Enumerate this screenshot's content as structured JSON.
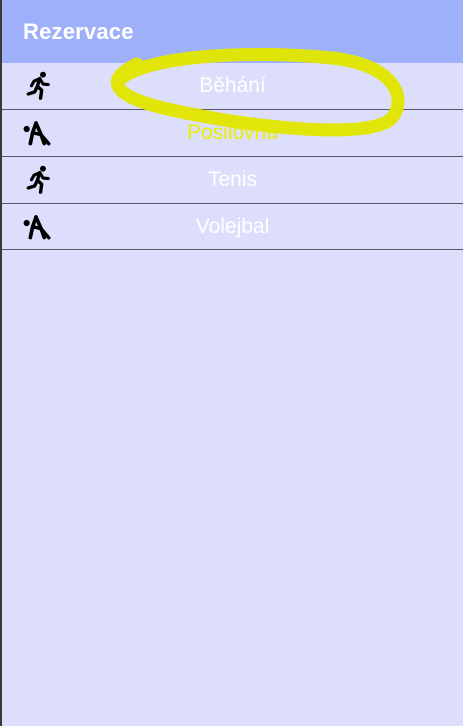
{
  "appbar": {
    "title": "Rezervace"
  },
  "list": {
    "items": [
      {
        "label": "Běhání",
        "icon": "running-person-icon"
      },
      {
        "label": "Posilovna",
        "icon": "weightlifting-person-icon"
      },
      {
        "label": "Tenis",
        "icon": "running-person-icon"
      },
      {
        "label": "Volejbal",
        "icon": "weightlifting-person-icon"
      }
    ]
  },
  "colors": {
    "appbar_bg": "#9fb0fb",
    "screen_bg": "#dcdefc",
    "label_text": "#ffffff",
    "annotation_yellow": "#e6f000"
  }
}
